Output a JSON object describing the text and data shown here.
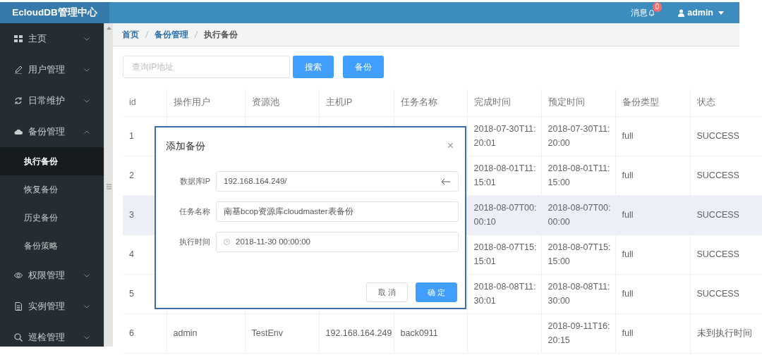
{
  "header": {
    "logo": "EcloudDB管理中心",
    "messages": {
      "label": "消息",
      "badge": "0"
    },
    "user": "admin"
  },
  "sidebar": {
    "items": [
      {
        "label": "主页",
        "expanded": false
      },
      {
        "label": "用户管理",
        "expanded": false
      },
      {
        "label": "日常维护",
        "expanded": false
      },
      {
        "label": "备份管理",
        "expanded": true,
        "children": [
          {
            "label": "执行备份",
            "selected": true
          },
          {
            "label": "恢复备份",
            "selected": false
          },
          {
            "label": "历史备份",
            "selected": false
          },
          {
            "label": "备份策略",
            "selected": false
          }
        ]
      },
      {
        "label": "权限管理",
        "expanded": false
      },
      {
        "label": "实例管理",
        "expanded": false
      },
      {
        "label": "巡检管理",
        "expanded": false
      }
    ]
  },
  "breadcrumb": [
    "首页",
    "备份管理",
    "执行备份"
  ],
  "search": {
    "placeholder": "查询IP地址",
    "buttons": [
      "搜索",
      "备份"
    ]
  },
  "table": {
    "columns": [
      "id",
      "操作用户",
      "资源池",
      "主机IP",
      "任务名称",
      "完成时间",
      "预定时间",
      "备份类型",
      "状态"
    ],
    "rows": [
      {
        "selected": false,
        "cells": [
          "1",
          null,
          null,
          null,
          null,
          "2018-07-30T11:\n20:01",
          "2018-07-30T11:\n20:00",
          "full",
          "SUCCESS"
        ]
      },
      {
        "selected": false,
        "cells": [
          "2",
          null,
          null,
          null,
          null,
          "2018-08-01T11:\n15:01",
          "2018-08-01T11:\n15:00",
          "full",
          "SUCCESS"
        ]
      },
      {
        "selected": true,
        "cells": [
          "3",
          null,
          null,
          null,
          null,
          "2018-08-07T00:\n00:10",
          "2018-08-07T00:\n00:00",
          "full",
          "SUCCESS"
        ]
      },
      {
        "selected": false,
        "cells": [
          "4",
          null,
          null,
          null,
          null,
          "2018-08-07T15:\n15:01",
          "2018-08-07T15:\n15:00",
          "full",
          "SUCCESS"
        ]
      },
      {
        "selected": false,
        "cells": [
          "5",
          null,
          null,
          null,
          null,
          "2018-08-08T11:\n30:01",
          "2018-08-08T11:\n30:00",
          "full",
          "SUCCESS"
        ]
      },
      {
        "selected": false,
        "cells": [
          "6",
          "admin",
          "TestEnv",
          "192.168.164.249",
          "back0911",
          null,
          "2018-09-11T16:\n20:15",
          "full",
          "未到执行时间"
        ]
      }
    ]
  },
  "dialog": {
    "title": "添加备份",
    "close": "×",
    "fields": [
      {
        "label": "数据库IP",
        "value": "192.168.164.249/",
        "kind": "back"
      },
      {
        "label": "任务名称",
        "value": "南基bcop资源库cloudmaster表备份",
        "kind": "text"
      },
      {
        "label": "执行时间",
        "value": "2018-11-30 00:00:00",
        "kind": "datetime"
      }
    ],
    "buttons": [
      {
        "label": "取 消",
        "kind": "default"
      },
      {
        "label": "确 定",
        "kind": "primary"
      }
    ]
  }
}
